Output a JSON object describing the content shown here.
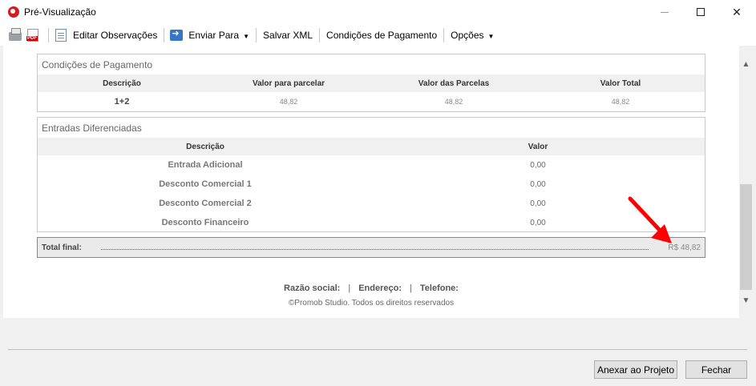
{
  "window": {
    "title": "Pré-Visualização"
  },
  "toolbar": {
    "items": [
      "Editar Observações",
      "Enviar Para",
      "Salvar XML",
      "Condições de Pagamento",
      "Opções"
    ]
  },
  "condicoes": {
    "title": "Condições de Pagamento",
    "headers": [
      "Descrição",
      "Valor para parcelar",
      "Valor das Parcelas",
      "Valor Total"
    ],
    "row": [
      "1+2",
      "48,82",
      "48,82",
      "48,82"
    ]
  },
  "entradas": {
    "title": "Entradas Diferenciadas",
    "headers": [
      "Descrição",
      "Valor"
    ],
    "rows": [
      [
        "Entrada Adicional",
        "0,00"
      ],
      [
        "Desconto Comercial 1",
        "0,00"
      ],
      [
        "Desconto Comercial 2",
        "0,00"
      ],
      [
        "Desconto Financeiro",
        "0,00"
      ]
    ]
  },
  "total": {
    "label": "Total final:",
    "value": "R$ 48,82"
  },
  "footer": {
    "razao": "Razão social:",
    "endereco": "Endereço:",
    "telefone": "Telefone:",
    "copyright": "©Promob Studio. Todos os direitos reservados"
  },
  "buttons": {
    "anexar": "Anexar ao Projeto",
    "fechar": "Fechar"
  },
  "colors": {
    "arrow": "#ff0000",
    "app_icon": "#d71920"
  }
}
